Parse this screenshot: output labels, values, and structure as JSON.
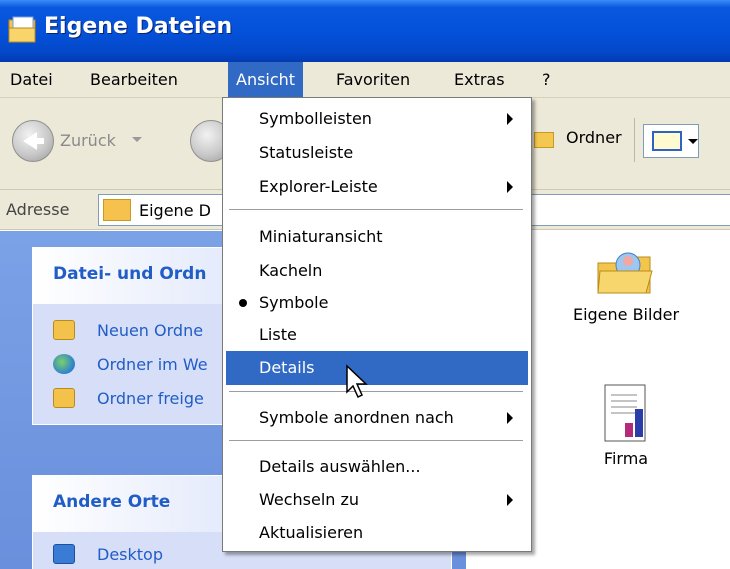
{
  "window": {
    "title": "Eigene Dateien"
  },
  "menubar": {
    "items": [
      {
        "label": "Datei"
      },
      {
        "label": "Bearbeiten"
      },
      {
        "label": "Ansicht"
      },
      {
        "label": "Favoriten"
      },
      {
        "label": "Extras"
      },
      {
        "label": "?"
      }
    ],
    "active": "Ansicht"
  },
  "toolbar": {
    "back_label": "Zurück",
    "folders_label": "Ordner"
  },
  "address": {
    "label": "Adresse",
    "value": "Eigene D"
  },
  "taskpane": {
    "group1_title": "Datei- und Ordn",
    "group1_tasks": [
      {
        "label": "Neuen Ordne",
        "icon": "new-folder-icon"
      },
      {
        "label": "Ordner im We",
        "icon": "web-publish-icon"
      },
      {
        "label": "Ordner freige",
        "icon": "share-folder-icon"
      }
    ],
    "group2_title": "Andere Orte",
    "group2_tasks": [
      {
        "label": "Desktop",
        "icon": "desktop-icon"
      }
    ]
  },
  "content": {
    "items": [
      {
        "label": "Eigene Bilder",
        "icon": "my-pictures-folder-icon"
      },
      {
        "label": "Firma",
        "icon": "document-chart-icon"
      }
    ]
  },
  "view_menu": {
    "items": [
      {
        "label": "Symbolleisten",
        "submenu": true
      },
      {
        "label": "Statusleiste"
      },
      {
        "label": "Explorer-Leiste",
        "submenu": true
      },
      {
        "label": "Miniaturansicht"
      },
      {
        "label": "Kacheln"
      },
      {
        "label": "Symbole",
        "checked": true
      },
      {
        "label": "Liste"
      },
      {
        "label": "Details",
        "highlighted": true
      },
      {
        "label": "Symbole anordnen nach",
        "submenu": true
      },
      {
        "label": "Details auswählen..."
      },
      {
        "label": "Wechseln zu",
        "submenu": true
      },
      {
        "label": "Aktualisieren"
      }
    ]
  },
  "colors": {
    "titlebar": "#0450d8",
    "menu_highlight": "#316ac5",
    "taskpane_link": "#215dc6",
    "taskpane_bg": "#6a8fdc"
  }
}
